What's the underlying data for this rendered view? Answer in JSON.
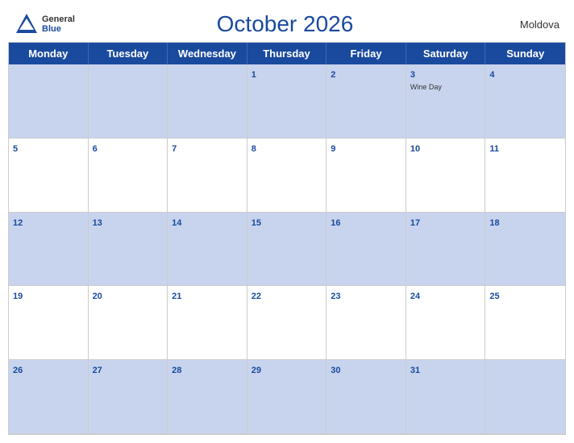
{
  "header": {
    "logo_general": "General",
    "logo_blue": "Blue",
    "title": "October 2026",
    "country": "Moldova"
  },
  "days": [
    "Monday",
    "Tuesday",
    "Wednesday",
    "Thursday",
    "Friday",
    "Saturday",
    "Sunday"
  ],
  "weeks": [
    [
      {
        "num": "",
        "event": ""
      },
      {
        "num": "",
        "event": ""
      },
      {
        "num": "",
        "event": ""
      },
      {
        "num": "1",
        "event": ""
      },
      {
        "num": "2",
        "event": ""
      },
      {
        "num": "3",
        "event": "Wine Day"
      },
      {
        "num": "4",
        "event": ""
      }
    ],
    [
      {
        "num": "5",
        "event": ""
      },
      {
        "num": "6",
        "event": ""
      },
      {
        "num": "7",
        "event": ""
      },
      {
        "num": "8",
        "event": ""
      },
      {
        "num": "9",
        "event": ""
      },
      {
        "num": "10",
        "event": ""
      },
      {
        "num": "11",
        "event": ""
      }
    ],
    [
      {
        "num": "12",
        "event": ""
      },
      {
        "num": "13",
        "event": ""
      },
      {
        "num": "14",
        "event": ""
      },
      {
        "num": "15",
        "event": ""
      },
      {
        "num": "16",
        "event": ""
      },
      {
        "num": "17",
        "event": ""
      },
      {
        "num": "18",
        "event": ""
      }
    ],
    [
      {
        "num": "19",
        "event": ""
      },
      {
        "num": "20",
        "event": ""
      },
      {
        "num": "21",
        "event": ""
      },
      {
        "num": "22",
        "event": ""
      },
      {
        "num": "23",
        "event": ""
      },
      {
        "num": "24",
        "event": ""
      },
      {
        "num": "25",
        "event": ""
      }
    ],
    [
      {
        "num": "26",
        "event": ""
      },
      {
        "num": "27",
        "event": ""
      },
      {
        "num": "28",
        "event": ""
      },
      {
        "num": "29",
        "event": ""
      },
      {
        "num": "30",
        "event": ""
      },
      {
        "num": "31",
        "event": ""
      },
      {
        "num": "",
        "event": ""
      }
    ]
  ],
  "colors": {
    "header_bg": "#1a4a9e",
    "row_blue": "#c8d4ee",
    "cell_num": "#1a4a9e"
  }
}
